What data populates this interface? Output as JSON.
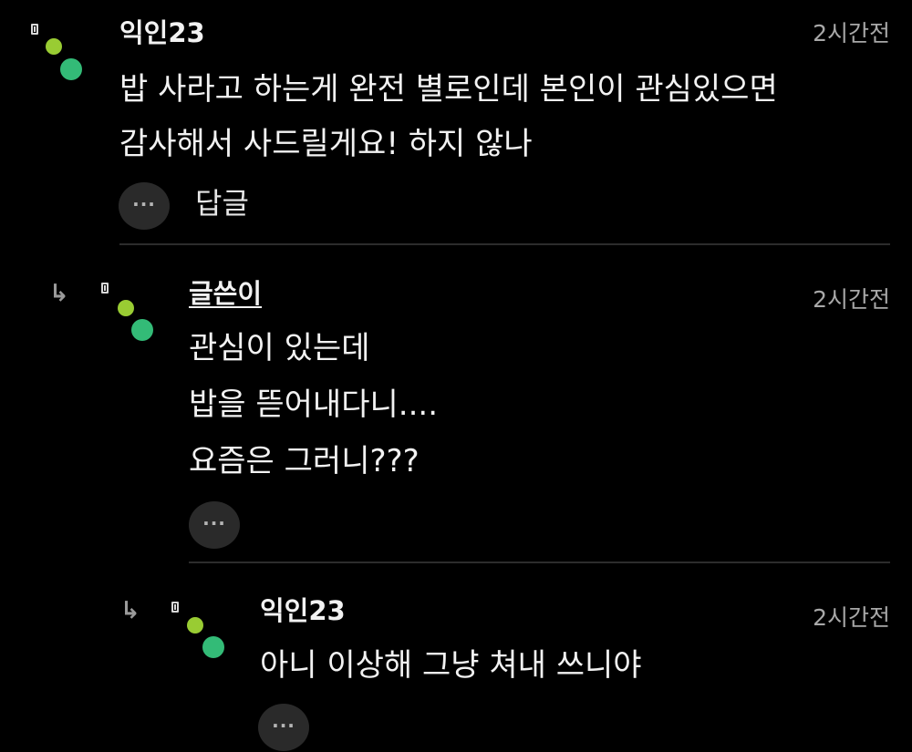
{
  "comments": [
    {
      "nickname": "익인23",
      "time": "2시간전",
      "lines": [
        "밥 사라고 하는게 완전 별로인데 본인이 관심있으면",
        "감사해서 사드릴게요! 하지 않나"
      ],
      "more_icon": "···",
      "reply_label": "답글"
    },
    {
      "nickname": "글쓴이",
      "time": "2시간전",
      "lines": [
        "관심이 있는데",
        "밥을 뜯어내다니....",
        "요즘은 그러니???"
      ],
      "more_icon": "···",
      "reply_arrow": "↳"
    },
    {
      "nickname": "익인23",
      "time": "2시간전",
      "lines": [
        "아니 이상해 그냥 쳐내 쓰니야"
      ],
      "more_icon": "···",
      "reply_arrow": "↳"
    }
  ],
  "colors": {
    "background": "#000000",
    "text": "#f2f2f2",
    "time": "#a8a8a8",
    "dot_small": "#99cc33",
    "dot_large": "#33bb77",
    "divider": "#2c2c2c",
    "button_bg": "#2a2a2a"
  },
  "icons": {
    "badge": "phone-badge-icon",
    "more": "more-options-icon",
    "reply": "reply-arrow-icon",
    "avatar": "avatar-dots-icon"
  }
}
